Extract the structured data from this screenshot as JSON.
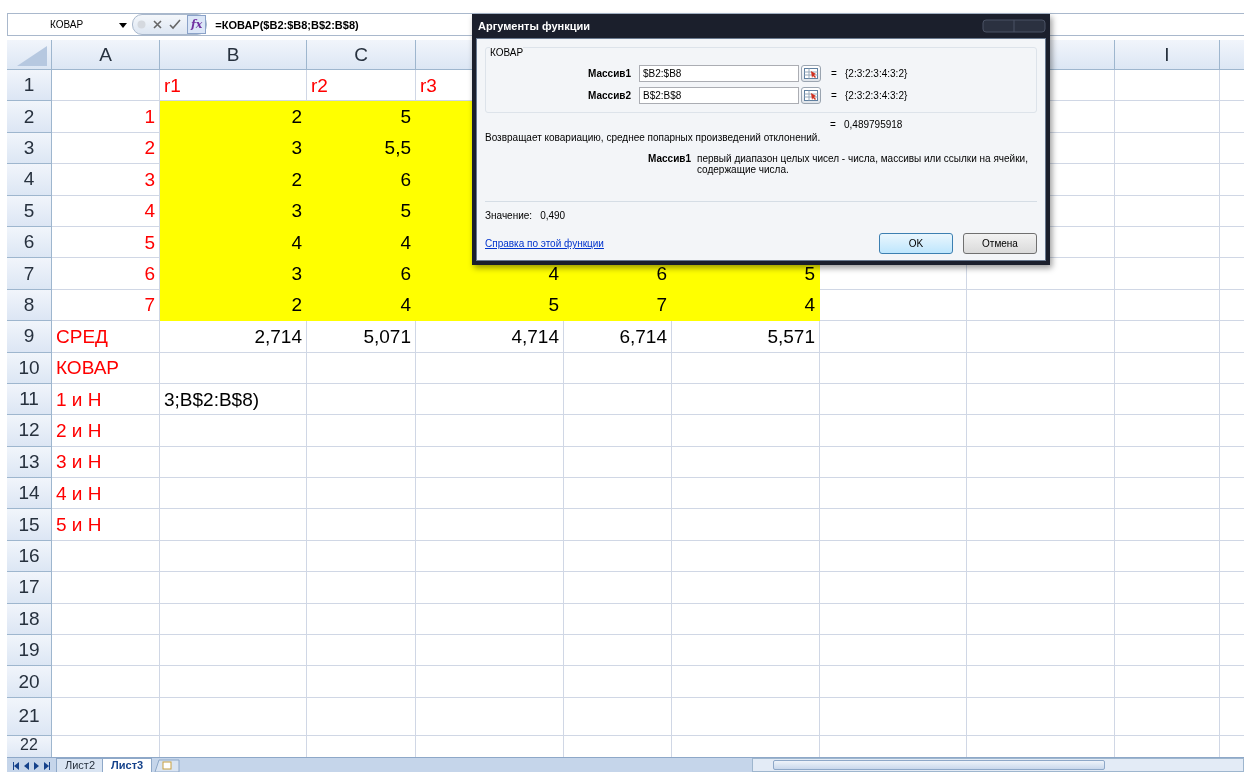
{
  "formula_bar": {
    "name_box": "КОВАР",
    "function_button": "fx",
    "formula": "=КОВАР($B2:$B8;B$2:B$8)"
  },
  "sheet": {
    "columns": [
      {
        "label": "A"
      },
      {
        "label": "B"
      },
      {
        "label": "C"
      },
      {},
      null,
      null,
      null,
      {},
      {
        "label": "I"
      },
      {}
    ],
    "rows": [
      {
        "number": "1",
        "cells": [
          null,
          {
            "text": "r1",
            "kind": "text",
            "color": "#ff0000",
            "highlighted": false
          },
          {
            "text": "r2",
            "kind": "text",
            "color": "#ff0000",
            "highlighted": false
          },
          {
            "text": "r3",
            "kind": "text",
            "color": "#ff0000",
            "highlighted": false
          }
        ]
      },
      {
        "number": "2",
        "cells": [
          {
            "text": "1",
            "kind": "number",
            "color": "#ff0000",
            "highlighted": false
          },
          {
            "text": "2",
            "kind": "number",
            "color": "#000000",
            "highlighted": true
          },
          {
            "text": "5",
            "kind": "number",
            "color": "#000000",
            "highlighted": true
          },
          {
            "highlighted": true
          }
        ]
      },
      {
        "number": "3",
        "cells": [
          {
            "text": "2",
            "kind": "number",
            "color": "#ff0000",
            "highlighted": false
          },
          {
            "text": "3",
            "kind": "number",
            "color": "#000000",
            "highlighted": true
          },
          {
            "text": "5,5",
            "kind": "number",
            "color": "#000000",
            "highlighted": true
          },
          {
            "highlighted": true
          }
        ]
      },
      {
        "number": "4",
        "cells": [
          {
            "text": "3",
            "kind": "number",
            "color": "#ff0000",
            "highlighted": false
          },
          {
            "text": "2",
            "kind": "number",
            "color": "#000000",
            "highlighted": true
          },
          {
            "text": "6",
            "kind": "number",
            "color": "#000000",
            "highlighted": true
          },
          {
            "highlighted": true
          }
        ]
      },
      {
        "number": "5",
        "cells": [
          {
            "text": "4",
            "kind": "number",
            "color": "#ff0000",
            "highlighted": false
          },
          {
            "text": "3",
            "kind": "number",
            "color": "#000000",
            "highlighted": true
          },
          {
            "text": "5",
            "kind": "number",
            "color": "#000000",
            "highlighted": true
          },
          {
            "highlighted": true
          }
        ]
      },
      {
        "number": "6",
        "cells": [
          {
            "text": "5",
            "kind": "number",
            "color": "#ff0000",
            "highlighted": false
          },
          {
            "text": "4",
            "kind": "number",
            "color": "#000000",
            "highlighted": true
          },
          {
            "text": "4",
            "kind": "number",
            "color": "#000000",
            "highlighted": true
          },
          {
            "highlighted": true
          }
        ]
      },
      {
        "number": "7",
        "cells": [
          {
            "text": "6",
            "kind": "number",
            "color": "#ff0000",
            "highlighted": false
          },
          {
            "text": "3",
            "kind": "number",
            "color": "#000000",
            "highlighted": true
          },
          {
            "text": "6",
            "kind": "number",
            "color": "#000000",
            "highlighted": true
          },
          {
            "text": "4",
            "kind": "number",
            "color": "#000000",
            "highlighted": true
          },
          {
            "text": "6",
            "kind": "number",
            "color": "#000000",
            "highlighted": true
          },
          {
            "text": "5",
            "kind": "number",
            "color": "#000000",
            "highlighted": true
          }
        ]
      },
      {
        "number": "8",
        "cells": [
          {
            "text": "7",
            "kind": "number",
            "color": "#ff0000",
            "highlighted": false
          },
          {
            "text": "2",
            "kind": "number",
            "color": "#000000",
            "highlighted": true
          },
          {
            "text": "4",
            "kind": "number",
            "color": "#000000",
            "highlighted": true
          },
          {
            "text": "5",
            "kind": "number",
            "color": "#000000",
            "highlighted": true
          },
          {
            "text": "7",
            "kind": "number",
            "color": "#000000",
            "highlighted": true
          },
          {
            "text": "4",
            "kind": "number",
            "color": "#000000",
            "highlighted": true
          }
        ]
      },
      {
        "number": "9",
        "cells": [
          {
            "text": "СРЕД",
            "kind": "text",
            "color": "#ff0000",
            "highlighted": false
          },
          {
            "text": "2,714",
            "kind": "number",
            "color": "#000000",
            "highlighted": false
          },
          {
            "text": "5,071",
            "kind": "number",
            "color": "#000000",
            "highlighted": false
          },
          {
            "text": "4,714",
            "kind": "number",
            "color": "#000000",
            "highlighted": false
          },
          {
            "text": "6,714",
            "kind": "number",
            "color": "#000000",
            "highlighted": false
          },
          {
            "text": "5,571",
            "kind": "number",
            "color": "#000000",
            "highlighted": false
          }
        ]
      },
      {
        "number": "10",
        "cells": [
          {
            "text": "КОВАР",
            "kind": "text",
            "color": "#ff0000",
            "highlighted": false
          }
        ]
      },
      {
        "number": "11",
        "cells": [
          {
            "text": "1 и Н",
            "kind": "text",
            "color": "#ff0000",
            "highlighted": false
          },
          {
            "text": "3;B$2:B$8)",
            "kind": "text",
            "color": "#000000",
            "highlighted": false
          }
        ]
      },
      {
        "number": "12",
        "cells": [
          {
            "text": "2 и Н",
            "kind": "text",
            "color": "#ff0000",
            "highlighted": false
          }
        ]
      },
      {
        "number": "13",
        "cells": [
          {
            "text": "3 и Н",
            "kind": "text",
            "color": "#ff0000",
            "highlighted": false
          }
        ]
      },
      {
        "number": "14",
        "cells": [
          {
            "text": "4 и Н",
            "kind": "text",
            "color": "#ff0000",
            "highlighted": false
          }
        ]
      },
      {
        "number": "15",
        "cells": [
          {
            "text": "5 и Н",
            "kind": "text",
            "color": "#ff0000",
            "highlighted": false
          }
        ]
      },
      {
        "number": "16",
        "cells": []
      },
      {
        "number": "17",
        "cells": []
      },
      {
        "number": "18",
        "cells": []
      },
      {
        "number": "19",
        "cells": []
      },
      {
        "number": "20",
        "cells": []
      },
      {
        "number": "21",
        "cells": []
      },
      {
        "number": "22",
        "cells": []
      }
    ]
  },
  "sheet_tabs": [
    {
      "label": "Лист2",
      "selected": false
    },
    {
      "label": "Лист3",
      "selected": true
    }
  ],
  "dialog": {
    "title": "Аргументы функции",
    "function_name": "КОВАР",
    "arguments": [
      {
        "label": "Массив1",
        "value": "$B2:$B8",
        "equals": "=",
        "result": "{2:3:2:3:4:3:2}"
      },
      {
        "label": "Массив2",
        "value": "B$2:B$8",
        "equals": "=",
        "result": "{2:3:2:3:4:3:2}"
      }
    ],
    "formula_equals": "=",
    "formula_result": "0,489795918",
    "description": "Возвращает ковариацию, среднее попарных произведений отклонений.",
    "argument_name": "Массив1",
    "argument_help": "первый диапазон целых чисел - числа, массивы или ссылки на ячейки, содержащие числа.",
    "value_label": "Значение:",
    "value": "0,490",
    "help_link": "Справка по этой функции",
    "buttons": [
      "OK",
      "Отмена"
    ]
  }
}
